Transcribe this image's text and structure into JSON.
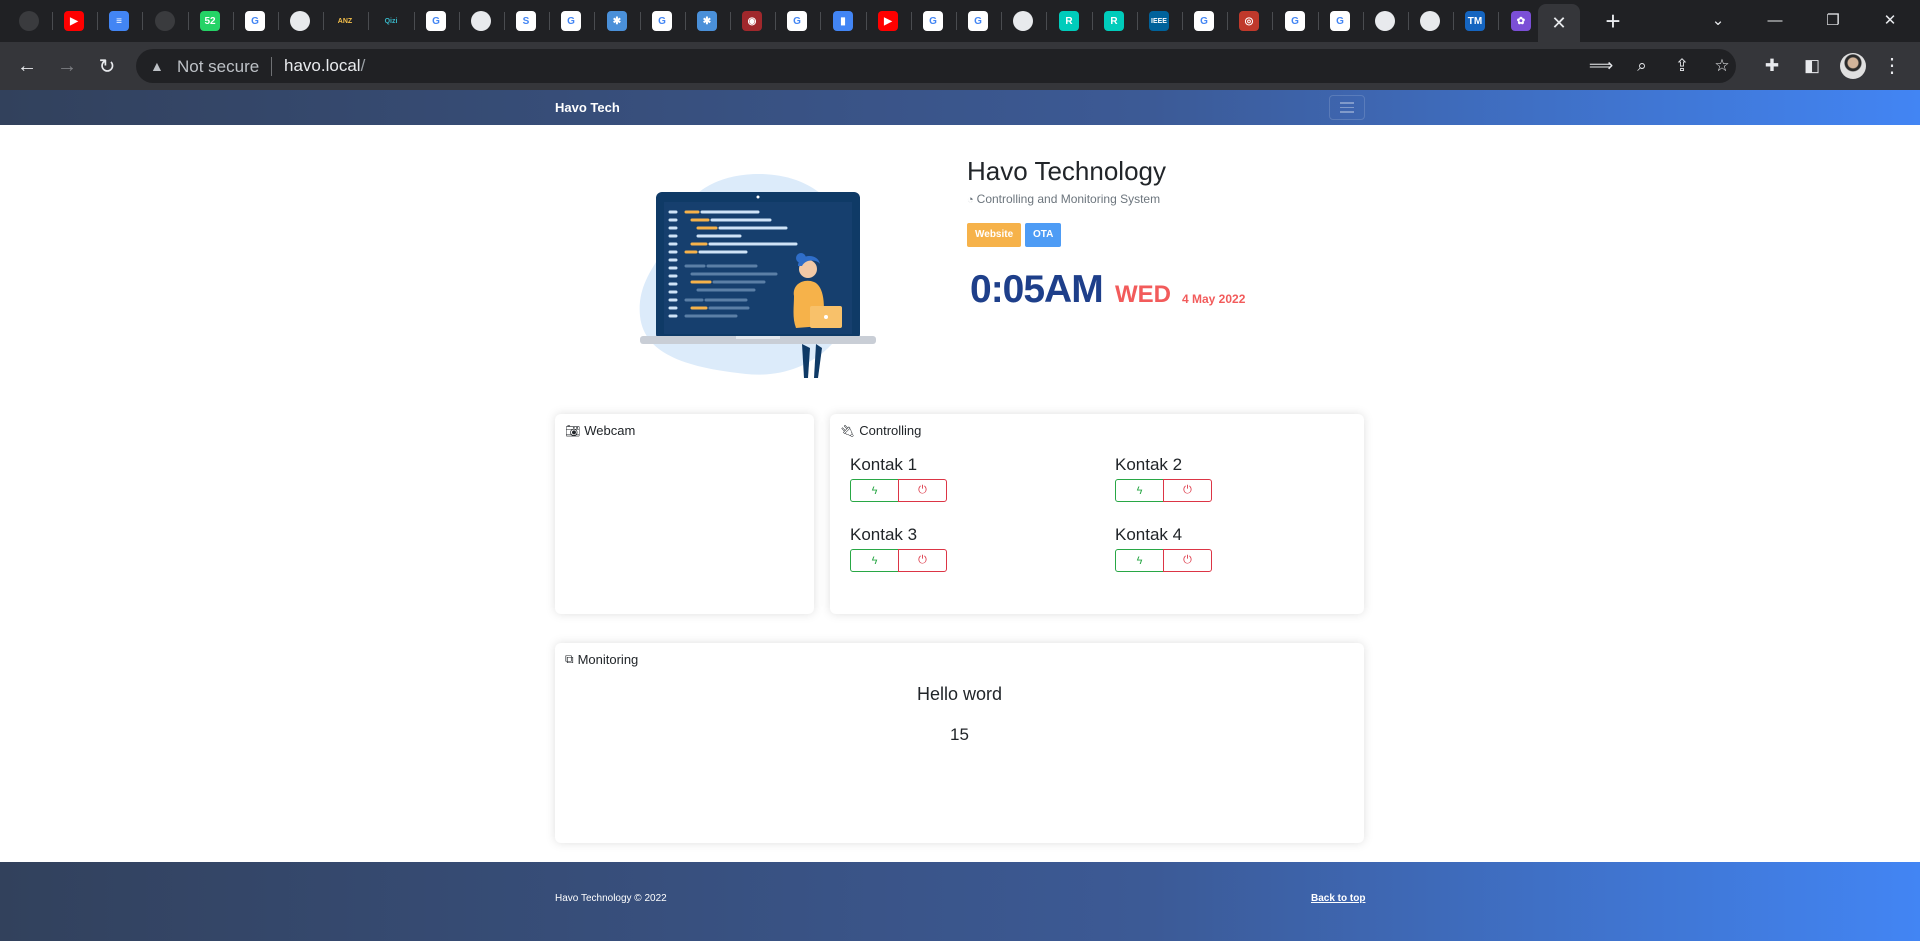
{
  "browser": {
    "tab_favicons": [
      {
        "icon": "github-icon",
        "color": "#24292f",
        "label": ""
      },
      {
        "icon": "youtube-icon",
        "color": "#ff0000",
        "label": "▶"
      },
      {
        "icon": "docs-icon",
        "color": "#4285f4",
        "label": "≡"
      },
      {
        "icon": "github-icon",
        "color": "#24292f",
        "label": ""
      },
      {
        "icon": "whatsapp-icon",
        "color": "#25d366",
        "label": "52"
      },
      {
        "icon": "google-icon",
        "color": "#ffffff",
        "label": "G"
      },
      {
        "icon": "globe-icon",
        "color": "#e8eaed",
        "label": ""
      },
      {
        "icon": "anz-icon",
        "color": "#202124",
        "label": "ANZ"
      },
      {
        "icon": "qizi-icon",
        "color": "#202124",
        "label": "Qizi"
      },
      {
        "icon": "google-icon",
        "color": "#ffffff",
        "label": "G"
      },
      {
        "icon": "globe-icon",
        "color": "#e8eaed",
        "label": ""
      },
      {
        "icon": "site-icon",
        "color": "#ffffff",
        "label": "S"
      },
      {
        "icon": "google-icon",
        "color": "#ffffff",
        "label": "G"
      },
      {
        "icon": "network-icon",
        "color": "#4a90d9",
        "label": "✱"
      },
      {
        "icon": "google-icon",
        "color": "#ffffff",
        "label": "G"
      },
      {
        "icon": "network-icon",
        "color": "#4a90d9",
        "label": "✱"
      },
      {
        "icon": "site-icon",
        "color": "#a0282c",
        "label": "◉"
      },
      {
        "icon": "google-icon",
        "color": "#ffffff",
        "label": "G"
      },
      {
        "icon": "file-icon",
        "color": "#4285f4",
        "label": "▮"
      },
      {
        "icon": "youtube-icon",
        "color": "#ff0000",
        "label": "▶"
      },
      {
        "icon": "google-icon",
        "color": "#ffffff",
        "label": "G"
      },
      {
        "icon": "google-icon",
        "color": "#ffffff",
        "label": "G"
      },
      {
        "icon": "globe-icon",
        "color": "#e8eaed",
        "label": ""
      },
      {
        "icon": "researchgate-icon",
        "color": "#00ccbb",
        "label": "R"
      },
      {
        "icon": "researchgate-icon",
        "color": "#00ccbb",
        "label": "R"
      },
      {
        "icon": "ieee-icon",
        "color": "#00629b",
        "label": "IEEE"
      },
      {
        "icon": "google-icon",
        "color": "#ffffff",
        "label": "G"
      },
      {
        "icon": "site-icon",
        "color": "#c0392b",
        "label": "◎"
      },
      {
        "icon": "google-icon",
        "color": "#ffffff",
        "label": "G"
      },
      {
        "icon": "google-icon",
        "color": "#ffffff",
        "label": "G"
      },
      {
        "icon": "globe-icon",
        "color": "#e8eaed",
        "label": ""
      },
      {
        "icon": "globe-icon",
        "color": "#e8eaed",
        "label": ""
      },
      {
        "icon": "tm-icon",
        "color": "#1565c0",
        "label": "TM"
      },
      {
        "icon": "site-icon",
        "color": "#7b4fd6",
        "label": "✿"
      }
    ],
    "active_tab_close": "✕",
    "new_tab": "+",
    "security_label": "Not secure",
    "url_host": "havo.local",
    "url_path": "/"
  },
  "site": {
    "brand": "Havo Tech",
    "title": "Havo Technology",
    "subtitle": "Controlling and Monitoring System",
    "badges": {
      "website": "Website",
      "ota": "OTA"
    },
    "clock": {
      "time": "0:05AM",
      "day": "WED",
      "date": "4 May 2022"
    }
  },
  "webcam": {
    "heading": "Webcam"
  },
  "controlling": {
    "heading": "Controlling",
    "kontak": [
      {
        "label": "Kontak 1"
      },
      {
        "label": "Kontak 2"
      },
      {
        "label": "Kontak 3"
      },
      {
        "label": "Kontak 4"
      }
    ]
  },
  "monitoring": {
    "heading": "Monitoring",
    "message": "Hello word",
    "value": "15"
  },
  "footer": {
    "copyright": "Havo Technology © 2022",
    "back_to_top": "Back to top"
  },
  "colors": {
    "nav_gradient_start": "#32415c",
    "nav_gradient_end": "#4285f4",
    "clock_time": "#1e3f8a",
    "clock_day": "#f25b5b",
    "badge_website": "#f6b24a",
    "badge_ota": "#4e9cf5",
    "on_button": "#28a745",
    "off_button": "#dc3545"
  }
}
